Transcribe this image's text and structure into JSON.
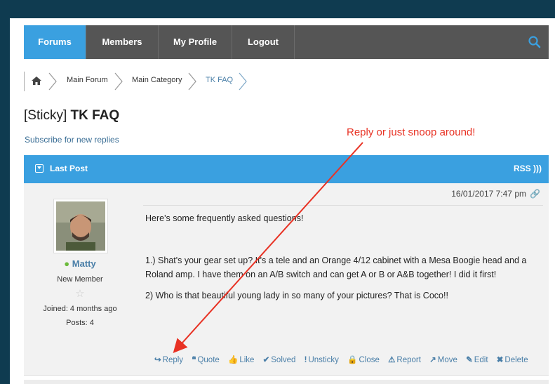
{
  "nav": {
    "items": [
      {
        "label": "Forums"
      },
      {
        "label": "Members"
      },
      {
        "label": "My Profile"
      },
      {
        "label": "Logout"
      }
    ],
    "active_color": "#3aa0e0"
  },
  "breadcrumb": {
    "items": [
      {
        "label": "Main Forum"
      },
      {
        "label": "Main Category"
      },
      {
        "label": "TK FAQ"
      }
    ]
  },
  "topic": {
    "prefix": "[Sticky]",
    "title": "TK FAQ",
    "subscribe": "Subscribe for new replies"
  },
  "annotation": "Reply or just snoop around!",
  "post_header": {
    "title": "Last Post",
    "rss": "RSS"
  },
  "post": {
    "date": "16/01/2017 7:47 pm",
    "author": {
      "name": "Matty",
      "rank": "New Member",
      "joined": "Joined: 4 months  ago",
      "posts": "Posts: 4"
    },
    "paragraphs": [
      "Here's some frequently asked questions!",
      "1.) Shat's your gear set up?  It's a tele and an Orange 4/12 cabinet with a Mesa Boogie head and a Roland amp.  I have them on an A/B switch and can get A or B or A&B together!  I did it first!",
      "2) Who is that beautiful young lady in so many of your pictures?   That is Coco!!"
    ],
    "actions": [
      {
        "icon": "↪",
        "label": "Reply"
      },
      {
        "icon": "❝",
        "label": "Quote"
      },
      {
        "icon": "👍",
        "label": "Like"
      },
      {
        "icon": "✔",
        "label": "Solved"
      },
      {
        "icon": "!",
        "label": "Unsticky"
      },
      {
        "icon": "🔒",
        "label": "Close"
      },
      {
        "icon": "⚠",
        "label": "Report"
      },
      {
        "icon": "↗",
        "label": "Move"
      },
      {
        "icon": "✎",
        "label": "Edit"
      },
      {
        "icon": "✖",
        "label": "Delete"
      }
    ]
  },
  "colors": {
    "frame": "#0f3b50",
    "accent": "#3aa0e0",
    "annotation": "#e83224",
    "link": "#4a7fa8"
  }
}
